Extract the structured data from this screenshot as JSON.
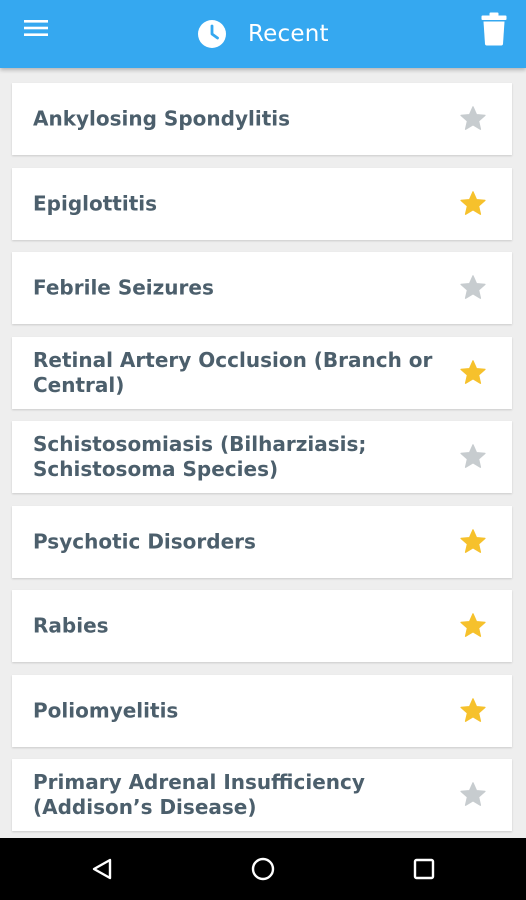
{
  "app_bar": {
    "title": "Recent",
    "background": "#35a8f0",
    "icons": {
      "menu": "menu-icon",
      "title": "clock-icon",
      "action": "trash-icon"
    }
  },
  "colors": {
    "favorite": "#f6c12c",
    "not_favorite": "#c7cccf",
    "item_text": "#4c5f6c",
    "list_background": "#eeeeee"
  },
  "items": [
    {
      "label": "Ankylosing Spondylitis",
      "favorite": false
    },
    {
      "label": "Epiglottitis",
      "favorite": true
    },
    {
      "label": "Febrile Seizures",
      "favorite": false
    },
    {
      "label": "Retinal Artery Occlusion (Branch or Central)",
      "favorite": true
    },
    {
      "label": "Schistosomiasis (Bilharziasis; Schistosoma Species)",
      "favorite": false
    },
    {
      "label": "Psychotic Disorders",
      "favorite": true
    },
    {
      "label": "Rabies",
      "favorite": true
    },
    {
      "label": "Poliomyelitis",
      "favorite": true
    },
    {
      "label": "Primary Adrenal Insufficiency (Addison’s Disease)",
      "favorite": false
    }
  ],
  "nav_bar": {
    "icons": [
      "back-icon",
      "home-icon",
      "recents-icon"
    ]
  }
}
